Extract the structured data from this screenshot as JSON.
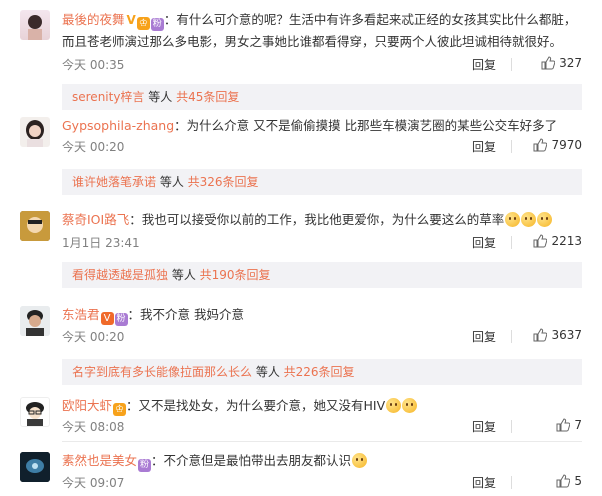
{
  "comments": [
    {
      "username": "最後的夜舞",
      "line1": "：有什么可介意的呢？生活中有许多看起来忒正经的女孩其实比什么都脏，",
      "line2": "而且苍老师演过那么多电影，男女之事她比谁都看得穿，只要两个人彼此坦诚相待就很好。",
      "time": "今天 00:35",
      "reply": "回复",
      "likes": "327",
      "more_user": "serenity梓言",
      "more_mid": " 等人 ",
      "more_count": "共45条回复"
    },
    {
      "username": "Gypsophila-zhang",
      "line1": "：为什么介意 又不是偷偷摸摸 比那些车模演艺圈的某些公交车好多了",
      "time": "今天 00:20",
      "reply": "回复",
      "likes": "7970",
      "more_user": "谁许她落笔承诺",
      "more_mid": " 等人 ",
      "more_count": "共326条回复"
    },
    {
      "username": "蔡奇IOI路飞",
      "line1": "：我也可以接受你以前的工作，我比他更爱你，为什么要这么的草率",
      "time": "1月1日 23:41",
      "reply": "回复",
      "likes": "2213",
      "more_user": "看得越透越是孤独",
      "more_mid": " 等人 ",
      "more_count": "共190条回复"
    },
    {
      "username": "东浩君",
      "line1": "：我不介意 我妈介意",
      "time": "今天 00:20",
      "reply": "回复",
      "likes": "3637",
      "more_user": "名字到底有多长能像拉面那么长么",
      "more_mid": " 等人 ",
      "more_count": "共226条回复"
    },
    {
      "username": "欧阳大虾",
      "line1": "：又不是找处女，为什么要介意，她又没有HIV",
      "time": "今天 08:08",
      "reply": "回复",
      "likes": "7"
    },
    {
      "username": "素然也是美女",
      "line1": "：不介意但是最怕带出去朋友都认识",
      "time": "今天 09:07",
      "reply": "回复",
      "likes": "5"
    }
  ],
  "icons": {
    "like": "thumbs-up-icon",
    "vip": "vip-badge-icon",
    "verified": "verified-v-icon",
    "fan": "fan-badge-icon",
    "emoji": "emoji-icon"
  },
  "colors": {
    "username": "#eb7350",
    "meta": "#808080",
    "more_bg": "#f2f2f5"
  }
}
